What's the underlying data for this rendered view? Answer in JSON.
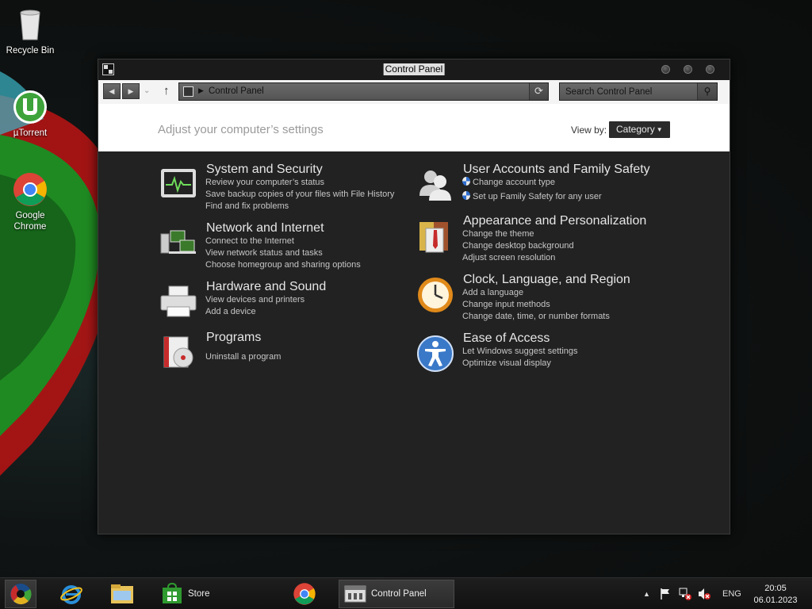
{
  "desktop": {
    "icons": [
      {
        "label": "Recycle Bin",
        "icon": "recycle-bin-icon"
      },
      {
        "label": "µTorrent",
        "icon": "utorrent-icon"
      },
      {
        "label": "Google Chrome",
        "icon": "chrome-icon"
      }
    ]
  },
  "window": {
    "title": "Control Panel",
    "address": {
      "path": "Control Panel"
    },
    "search": {
      "placeholder": "Search Control Panel"
    },
    "header": {
      "heading": "Adjust your computer’s settings",
      "view_by_label": "View by:",
      "view_by_value": "Category"
    },
    "categories": [
      {
        "title": "System and Security",
        "icon": "system-security-icon",
        "links": [
          "Review your computer’s status",
          "Save backup copies of your files with File History",
          "Find and fix problems"
        ]
      },
      {
        "title": "Network and Internet",
        "icon": "network-icon",
        "links": [
          "Connect to the Internet",
          "View network status and tasks",
          "Choose homegroup and sharing options"
        ]
      },
      {
        "title": "Hardware and Sound",
        "icon": "printer-icon",
        "links": [
          "View devices and printers",
          "Add a device"
        ]
      },
      {
        "title": "Programs",
        "icon": "programs-icon",
        "links": [
          "Uninstall a program"
        ]
      },
      {
        "title": "User Accounts and Family Safety",
        "icon": "users-icon",
        "links": [
          "Change account type",
          "Set up Family Safety for any user"
        ]
      },
      {
        "title": "Appearance and Personalization",
        "icon": "appearance-icon",
        "links": [
          "Change the theme",
          "Change desktop background",
          "Adjust screen resolution"
        ]
      },
      {
        "title": "Clock, Language, and Region",
        "icon": "clock-icon",
        "links": [
          "Add a language",
          "Change input methods",
          "Change date, time, or number formats"
        ]
      },
      {
        "title": "Ease of Access",
        "icon": "accessibility-icon",
        "links": [
          "Let Windows suggest settings",
          "Optimize visual display"
        ]
      }
    ]
  },
  "taskbar": {
    "items": [
      {
        "label": "",
        "icon": "start-icon"
      },
      {
        "label": "",
        "icon": "internet-explorer-icon"
      },
      {
        "label": "",
        "icon": "file-explorer-icon"
      },
      {
        "label": "Store",
        "icon": "store-icon"
      },
      {
        "label": "",
        "icon": "chrome-icon"
      },
      {
        "label": "Control Panel",
        "icon": "control-panel-icon"
      }
    ],
    "tray": {
      "language": "ENG",
      "time": "20:05",
      "date": "06.01.2023"
    }
  }
}
